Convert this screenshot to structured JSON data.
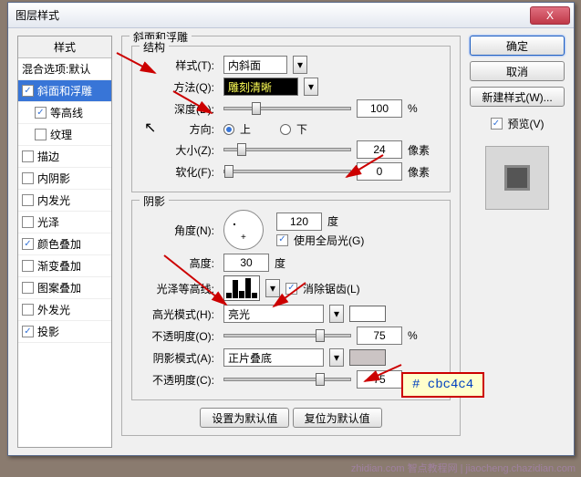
{
  "title": "图层样式",
  "close": "X",
  "styles": {
    "header": "样式",
    "blend": "混合选项:默认",
    "items": [
      {
        "label": "斜面和浮雕",
        "checked": true,
        "selected": true
      },
      {
        "label": "等高线",
        "checked": true,
        "sub": true
      },
      {
        "label": "纹理",
        "checked": false,
        "sub": true
      },
      {
        "label": "描边",
        "checked": false
      },
      {
        "label": "内阴影",
        "checked": false
      },
      {
        "label": "内发光",
        "checked": false
      },
      {
        "label": "光泽",
        "checked": false
      },
      {
        "label": "颜色叠加",
        "checked": true
      },
      {
        "label": "渐变叠加",
        "checked": false
      },
      {
        "label": "图案叠加",
        "checked": false
      },
      {
        "label": "外发光",
        "checked": false
      },
      {
        "label": "投影",
        "checked": true
      }
    ]
  },
  "bevel": {
    "section": "斜面和浮雕",
    "structure": "结构",
    "style_lbl": "样式(T):",
    "style_val": "内斜面",
    "technique_lbl": "方法(Q):",
    "technique_val": "雕刻清晰",
    "depth_lbl": "深度(D):",
    "depth_val": "100",
    "depth_unit": "%",
    "direction_lbl": "方向:",
    "up": "上",
    "down": "下",
    "size_lbl": "大小(Z):",
    "size_val": "24",
    "size_unit": "像素",
    "soften_lbl": "软化(F):",
    "soften_val": "0",
    "soften_unit": "像素"
  },
  "shading": {
    "section": "阴影",
    "angle_lbl": "角度(N):",
    "angle_val": "120",
    "angle_unit": "度",
    "global": "使用全局光(G)",
    "altitude_lbl": "高度:",
    "altitude_val": "30",
    "altitude_unit": "度",
    "gloss_lbl": "光泽等高线:",
    "antialias": "消除锯齿(L)",
    "highlight_lbl": "高光模式(H):",
    "highlight_val": "亮光",
    "opacity1_lbl": "不透明度(O):",
    "opacity1_val": "75",
    "pct": "%",
    "shadow_lbl": "阴影模式(A):",
    "shadow_val": "正片叠底",
    "opacity2_lbl": "不透明度(C):",
    "opacity2_val": "75"
  },
  "bottom": {
    "default": "设置为默认值",
    "reset": "复位为默认值"
  },
  "right": {
    "ok": "确定",
    "cancel": "取消",
    "new": "新建样式(W)...",
    "preview": "预览(V)"
  },
  "callout": "# cbc4c4",
  "watermark": "zhidian.com 智点教程网 | jiaocheng.chazidian.com"
}
